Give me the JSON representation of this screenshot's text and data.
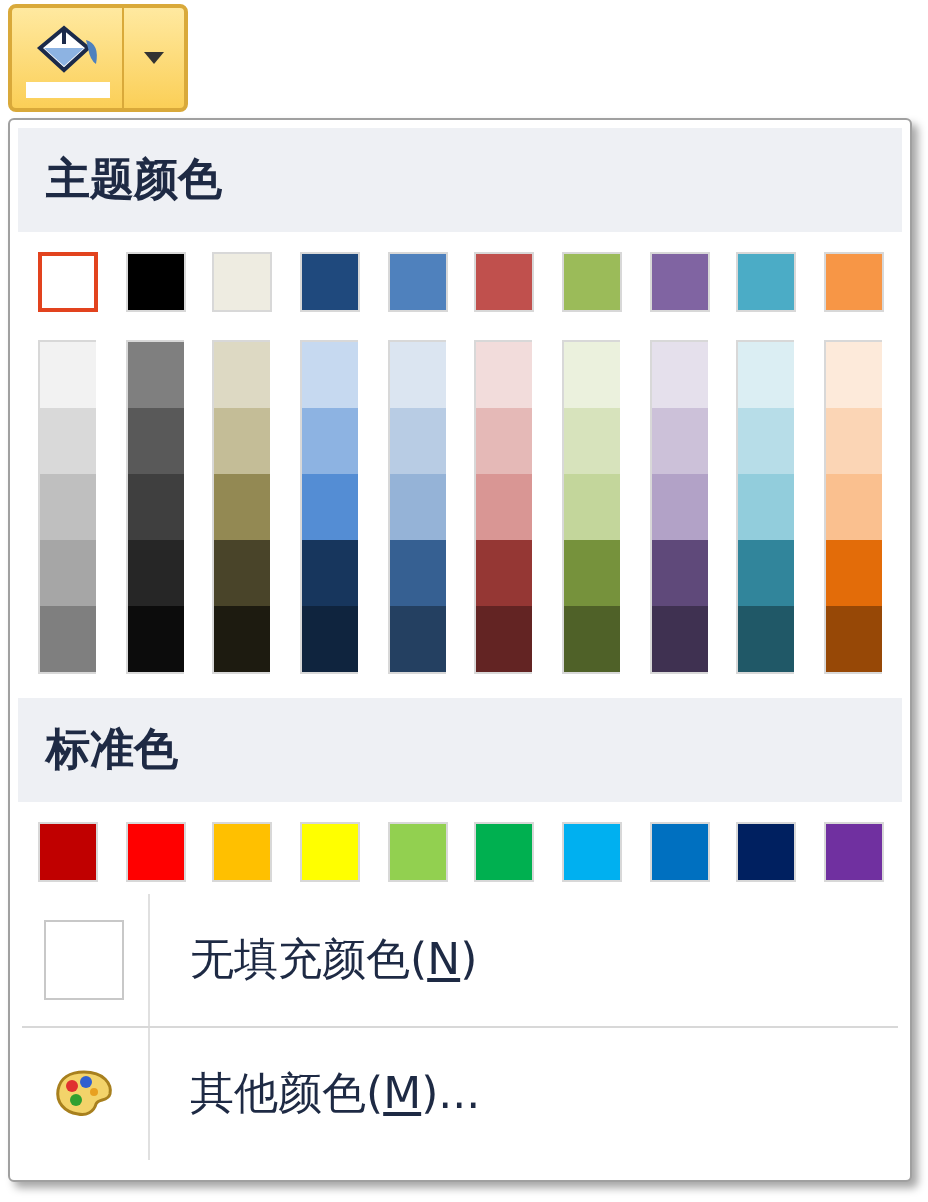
{
  "toolbar_button": {
    "pressed": true
  },
  "theme_colors": {
    "title": "主题颜色",
    "swatches": [
      {
        "color": "#ffffff",
        "selected": true
      },
      {
        "color": "#000000",
        "selected": false
      },
      {
        "color": "#eeece1",
        "selected": false
      },
      {
        "color": "#1f497d",
        "selected": false
      },
      {
        "color": "#4f81bd",
        "selected": false
      },
      {
        "color": "#c0504d",
        "selected": false
      },
      {
        "color": "#9bbb59",
        "selected": false
      },
      {
        "color": "#8064a2",
        "selected": false
      },
      {
        "color": "#4bacc6",
        "selected": false
      },
      {
        "color": "#f79646",
        "selected": false
      }
    ],
    "shade_columns": [
      {
        "shades": [
          {
            "color": "#f2f2f2",
            "selected": false
          },
          {
            "color": "#d9d9d9",
            "selected": false
          },
          {
            "color": "#bfbfbf",
            "selected": false
          },
          {
            "color": "#a6a6a6",
            "selected": false
          },
          {
            "color": "#7f7f7f",
            "selected": false
          }
        ]
      },
      {
        "shades": [
          {
            "color": "#7f7f7f",
            "selected": false
          },
          {
            "color": "#595959",
            "selected": false
          },
          {
            "color": "#3f3f3f",
            "selected": false
          },
          {
            "color": "#262626",
            "selected": false
          },
          {
            "color": "#0c0c0c",
            "selected": false
          }
        ]
      },
      {
        "shades": [
          {
            "color": "#ddd9c3",
            "selected": false
          },
          {
            "color": "#c4bd97",
            "selected": false
          },
          {
            "color": "#938953",
            "selected": false
          },
          {
            "color": "#494429",
            "selected": false
          },
          {
            "color": "#1d1b10",
            "selected": false
          }
        ]
      },
      {
        "shades": [
          {
            "color": "#c6d9f0",
            "selected": false
          },
          {
            "color": "#8db3e2",
            "selected": false
          },
          {
            "color": "#548dd4",
            "selected": false
          },
          {
            "color": "#17365d",
            "selected": false
          },
          {
            "color": "#0f243e",
            "selected": false
          }
        ]
      },
      {
        "shades": [
          {
            "color": "#dbe5f1",
            "selected": false
          },
          {
            "color": "#b8cce4",
            "selected": false
          },
          {
            "color": "#95b3d7",
            "selected": false
          },
          {
            "color": "#366092",
            "selected": false
          },
          {
            "color": "#244061",
            "selected": false
          }
        ]
      },
      {
        "shades": [
          {
            "color": "#f2dcdb",
            "selected": false
          },
          {
            "color": "#e5b9b7",
            "selected": false
          },
          {
            "color": "#d99694",
            "selected": false
          },
          {
            "color": "#953734",
            "selected": false
          },
          {
            "color": "#632423",
            "selected": false
          }
        ]
      },
      {
        "shades": [
          {
            "color": "#ebf1dd",
            "selected": false
          },
          {
            "color": "#d7e3bc",
            "selected": false
          },
          {
            "color": "#c3d69b",
            "selected": false
          },
          {
            "color": "#76923c",
            "selected": false
          },
          {
            "color": "#4f6128",
            "selected": false
          }
        ]
      },
      {
        "shades": [
          {
            "color": "#e5e0ec",
            "selected": false
          },
          {
            "color": "#ccc1d9",
            "selected": false
          },
          {
            "color": "#b2a2c7",
            "selected": false
          },
          {
            "color": "#5f497a",
            "selected": false
          },
          {
            "color": "#3f3151",
            "selected": false
          }
        ]
      },
      {
        "shades": [
          {
            "color": "#dbeef3",
            "selected": false
          },
          {
            "color": "#b7dde8",
            "selected": false
          },
          {
            "color": "#92cddc",
            "selected": false
          },
          {
            "color": "#31859b",
            "selected": false
          },
          {
            "color": "#205867",
            "selected": false
          }
        ]
      },
      {
        "shades": [
          {
            "color": "#fdeada",
            "selected": false
          },
          {
            "color": "#fbd5b5",
            "selected": false
          },
          {
            "color": "#fac08f",
            "selected": false
          },
          {
            "color": "#e36c09",
            "selected": false
          },
          {
            "color": "#974806",
            "selected": false
          }
        ]
      }
    ]
  },
  "standard_colors": {
    "title": "标准色",
    "swatches": [
      {
        "color": "#c00000",
        "selected": false
      },
      {
        "color": "#ff0000",
        "selected": false
      },
      {
        "color": "#ffc000",
        "selected": false
      },
      {
        "color": "#ffff00",
        "selected": false
      },
      {
        "color": "#92d050",
        "selected": false
      },
      {
        "color": "#00b050",
        "selected": false
      },
      {
        "color": "#00b0f0",
        "selected": false
      },
      {
        "color": "#0070c0",
        "selected": false
      },
      {
        "color": "#002060",
        "selected": false
      },
      {
        "color": "#7030a0",
        "selected": false
      }
    ]
  },
  "menu_items": [
    {
      "kind": "no_fill",
      "prefix": "无填充颜色(",
      "access_key": "N",
      "suffix": ")"
    },
    {
      "kind": "more",
      "prefix": "其他颜色(",
      "access_key": "M",
      "suffix": ")..."
    }
  ]
}
